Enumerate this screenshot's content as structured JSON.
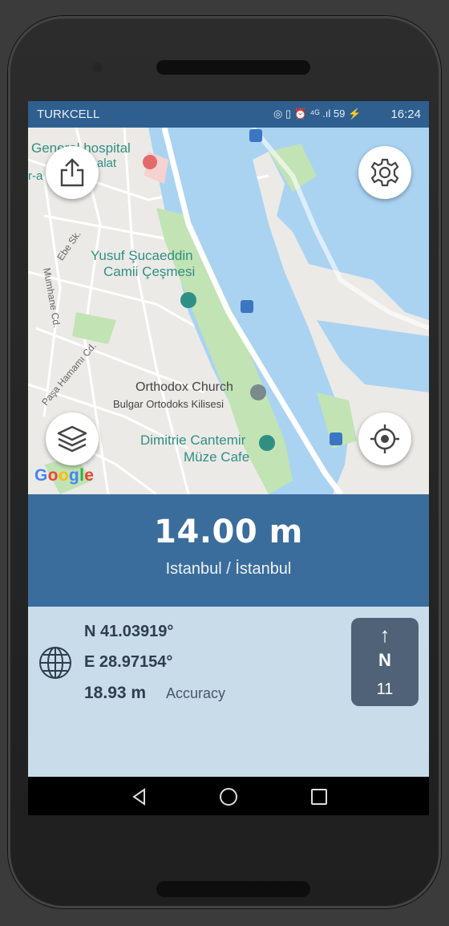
{
  "statusbar": {
    "carrier": "TURKCELL",
    "icons_text": "◎ ▯ ⏰ ⁴ᴳ .ıl 59 ⚡",
    "time": "16:24"
  },
  "map": {
    "labels": {
      "hospital": "General hospital",
      "balat": "el Balat",
      "stanesi": "r-a      stanesi",
      "yusuf1": "Yusuf Şucaeddin",
      "yusuf2": "Camii Çeşmesi",
      "church1": "Orthodox Church",
      "church2": "Bulgar Ortodoks Kilisesi",
      "dimitrie1": "Dimitrie Cantemir",
      "dimitrie2": "Müze Cafe",
      "street_ebe": "Ebe Sk.",
      "street_mumhane": "Mumhane Cd.",
      "street_hamam": "Paşa Hamamı Cd.",
      "google": "Google"
    },
    "buttons": {
      "share_icon": "share-icon",
      "settings_icon": "gear-icon",
      "layers_icon": "layers-icon",
      "locate_icon": "crosshair-icon"
    }
  },
  "altitude": {
    "value": "14.00 m",
    "place": "Istanbul / İstanbul"
  },
  "coordinates": {
    "lat": "N 41.03919°",
    "lon": "E 28.97154°",
    "accuracy_value": "18.93 m",
    "accuracy_label": "Accuracy"
  },
  "compass": {
    "arrow": "↑",
    "direction": "N",
    "degrees": "11"
  },
  "colors": {
    "statusbar": "#2e5f8f",
    "altitude_panel": "#3a6d9c",
    "coords_panel": "#c9dcea",
    "compass_box": "#4f6277",
    "water": "#aad3f2",
    "park": "#c2e3b4"
  }
}
